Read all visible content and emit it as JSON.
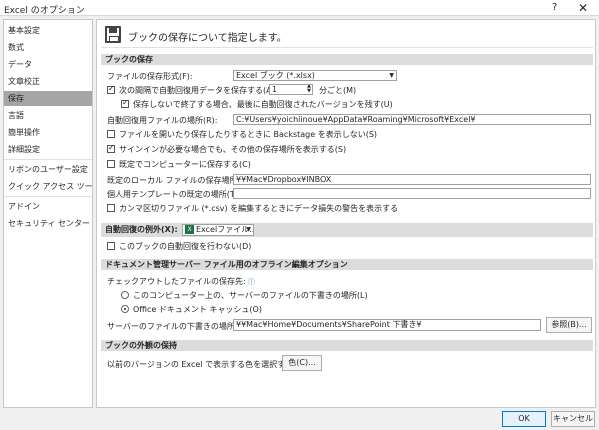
{
  "window": {
    "title": "Excel のオプション",
    "help_label": "?",
    "close_label": "✕"
  },
  "sidebar": {
    "items": [
      {
        "label": "基本設定"
      },
      {
        "label": "数式"
      },
      {
        "label": "データ"
      },
      {
        "label": "文章校正"
      },
      {
        "label": "保存",
        "selected": true
      },
      {
        "label": "言語"
      },
      {
        "label": "簡単操作"
      },
      {
        "label": "詳細設定"
      },
      {
        "label": "リボンのユーザー設定"
      },
      {
        "label": "クイック アクセス ツール バー"
      },
      {
        "label": "アドイン"
      },
      {
        "label": "セキュリティ センター"
      }
    ]
  },
  "header": {
    "text": "ブックの保存について指定します。",
    "icon": "save-icon"
  },
  "save_section": {
    "title": "ブックの保存",
    "format_label": "ファイルの保存形式(F):",
    "format_value": "Excel ブック (*.xlsx)",
    "autorecover_label": "次の間隔で自動回復用データを保存する(A):",
    "autorecover_checked": true,
    "autorecover_minutes": "1",
    "minutes_suffix": "分ごと(M)",
    "keep_last_label": "保存しないで終了する場合、最後に自動回復されたバージョンを残す(U)",
    "keep_last_checked": true,
    "autorecover_location_label": "自動回復用ファイルの場所(R):",
    "autorecover_location_value": "C:¥Users¥yoichiinoue¥AppData¥Roaming¥Microsoft¥Excel¥",
    "no_backstage_label": "ファイルを開いたり保存したりするときに Backstage を表示しない(S)",
    "no_backstage_checked": false,
    "show_additional_label": "サインインが必要な場合でも、その他の保存場所を表示する(S)",
    "show_additional_checked": true,
    "default_computer_label": "既定でコンピューターに保存する(C)",
    "default_computer_checked": false,
    "default_local_label": "既定のローカル ファイルの保存場所(I):",
    "default_local_value": "¥¥Mac¥Dropbox¥INBOX",
    "personal_template_label": "個人用テンプレートの既定の場所(T):",
    "personal_template_value": "",
    "csv_warning_label": "カンマ区切りファイル (*.csv) を編集するときにデータ損失の警告を表示する",
    "csv_warning_checked": false
  },
  "autorecover_exceptions": {
    "title": "自動回復の例外(X):",
    "workbook_value": "Excelファイル...",
    "disable_label": "このブックの自動回復を行わない(D)",
    "disable_checked": false
  },
  "offline_section": {
    "title": "ドキュメント管理サーバー ファイル用のオフライン編集オプション",
    "checkout_label": "チェックアウトしたファイルの保存先:",
    "option1_label": "このコンピューター上の、サーバーのファイルの下書きの場所(L)",
    "option1_selected": false,
    "option2_label": "Office ドキュメント キャッシュ(O)",
    "option2_selected": true,
    "drafts_label": "サーバーのファイルの下書きの場所(V):",
    "drafts_value": "¥¥Mac¥Home¥Documents¥SharePoint 下書き¥",
    "browse_label": "参照(B)..."
  },
  "visual_section": {
    "title": "ブックの外観の保持",
    "colors_label": "以前のバージョンの Excel で表示する色を選択する:",
    "colors_button": "色(C)..."
  },
  "footer": {
    "ok_label": "OK",
    "cancel_label": "キャンセル"
  }
}
